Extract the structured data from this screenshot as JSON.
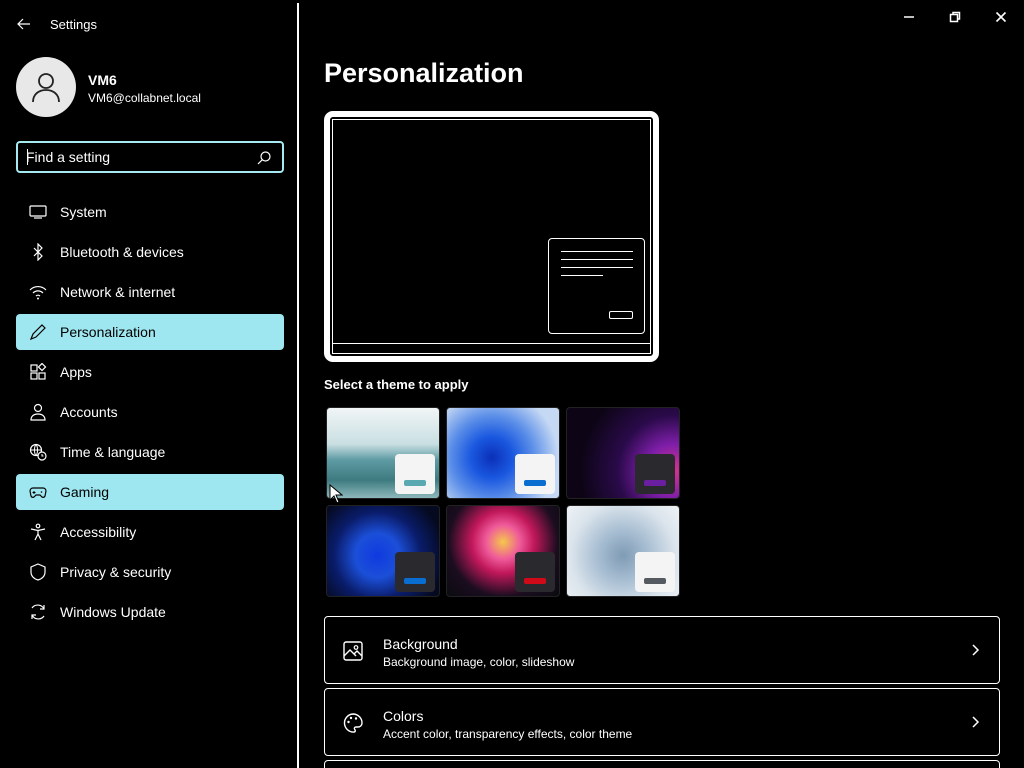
{
  "window": {
    "app_title": "Settings"
  },
  "user": {
    "name": "VM6",
    "email": "VM6@collabnet.local"
  },
  "search": {
    "placeholder": "Find a setting",
    "icon": "search-icon"
  },
  "nav": [
    {
      "label": "System",
      "icon": "monitor-icon",
      "active": false
    },
    {
      "label": "Bluetooth & devices",
      "icon": "bluetooth-icon",
      "active": false
    },
    {
      "label": "Network & internet",
      "icon": "wifi-icon",
      "active": false
    },
    {
      "label": "Personalization",
      "icon": "pen-icon",
      "active": true
    },
    {
      "label": "Apps",
      "icon": "apps-icon",
      "active": false
    },
    {
      "label": "Accounts",
      "icon": "person-icon",
      "active": false
    },
    {
      "label": "Time & language",
      "icon": "globe-clock-icon",
      "active": false
    },
    {
      "label": "Gaming",
      "icon": "gamepad-icon",
      "active": true
    },
    {
      "label": "Accessibility",
      "icon": "accessibility-icon",
      "active": false
    },
    {
      "label": "Privacy & security",
      "icon": "shield-icon",
      "active": false
    },
    {
      "label": "Windows Update",
      "icon": "sync-icon",
      "active": false
    }
  ],
  "main": {
    "title": "Personalization",
    "theme_label": "Select a theme to apply",
    "themes": [
      {
        "name": "lake",
        "accent": "#5aa8b0"
      },
      {
        "name": "bloom-light",
        "accent": "#0a6ed1"
      },
      {
        "name": "glow",
        "accent": "#6a1fa0"
      },
      {
        "name": "bloom-dark",
        "accent": "#0a6ed1"
      },
      {
        "name": "flow",
        "accent": "#d10a1a"
      },
      {
        "name": "sunrise",
        "accent": "#555a60"
      }
    ],
    "cards": [
      {
        "title": "Background",
        "subtitle": "Background image, color, slideshow",
        "icon": "image-icon"
      },
      {
        "title": "Colors",
        "subtitle": "Accent color, transparency effects, color theme",
        "icon": "palette-icon"
      }
    ]
  },
  "colors": {
    "highlight": "#9fe7f0",
    "background": "#000000",
    "text": "#ffffff"
  }
}
